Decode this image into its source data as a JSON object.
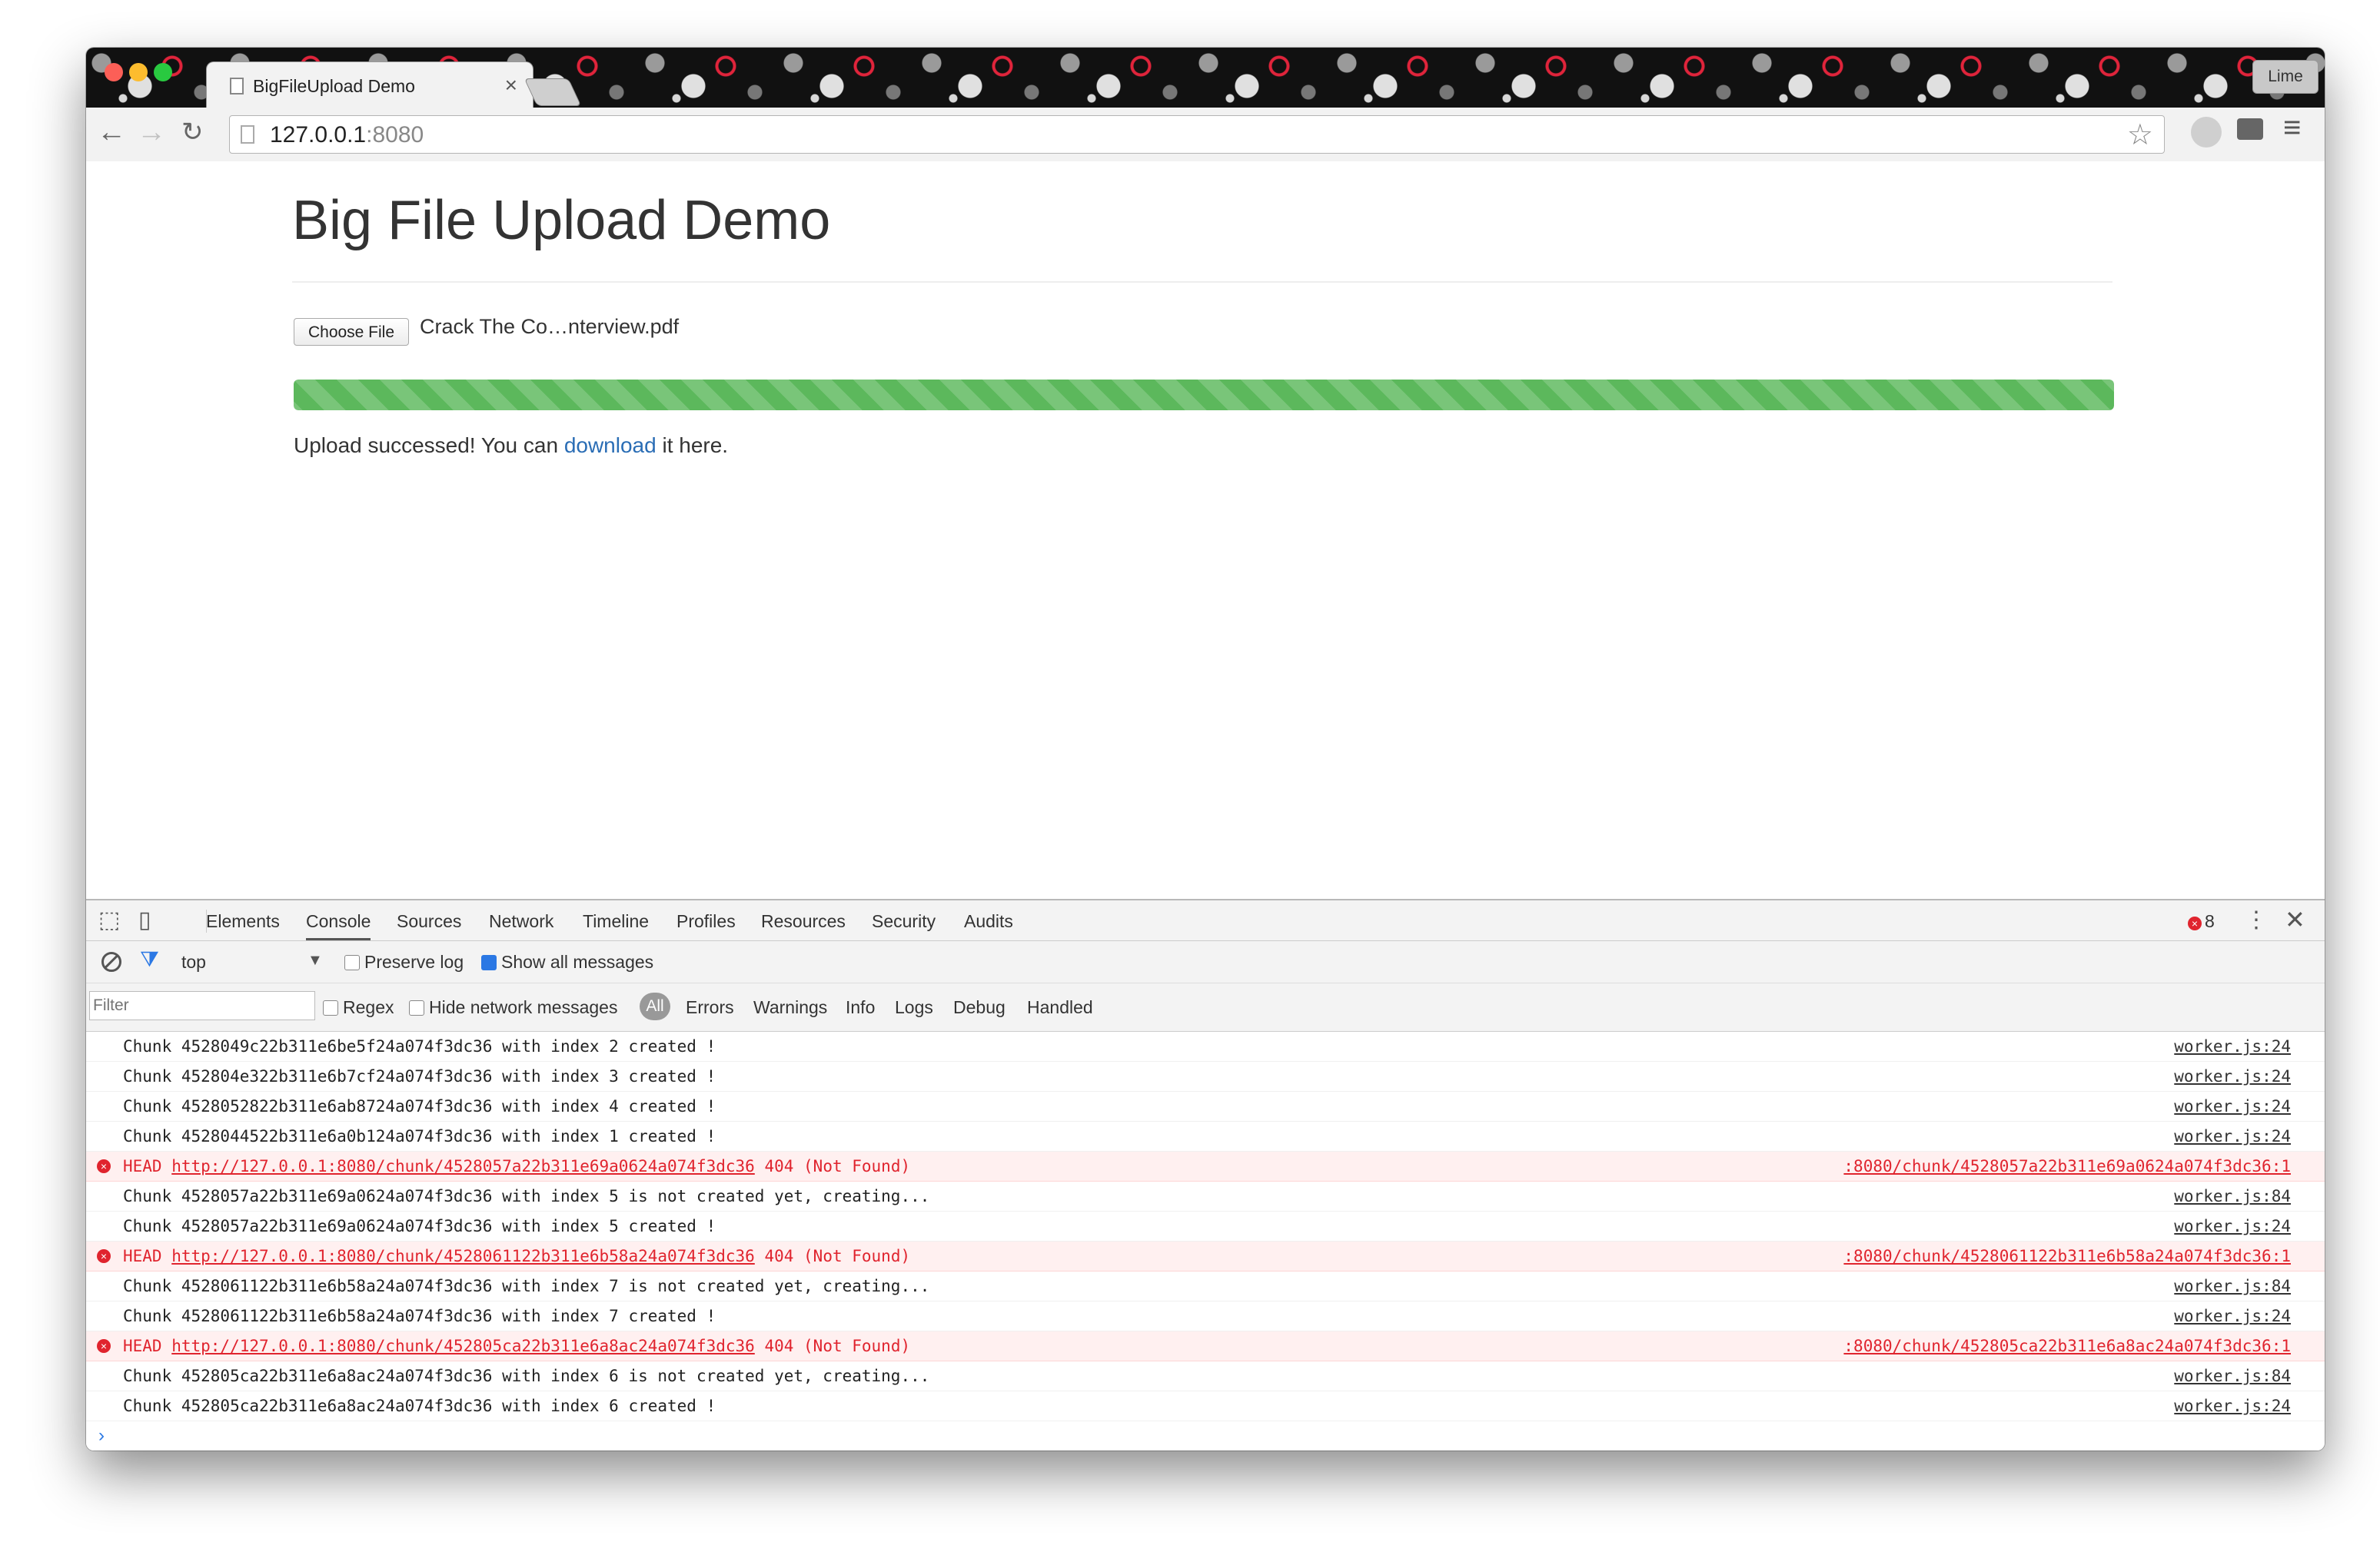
{
  "browser": {
    "tab_title": "BigFileUpload Demo",
    "tab_close": "×",
    "profile_name": "Lime",
    "url_host": "127.0.0.1",
    "url_port": ":8080"
  },
  "page": {
    "title": "Big File Upload Demo",
    "choose_file_label": "Choose File",
    "file_name": "Crack The Co…nterview.pdf",
    "progress_percent": 100,
    "status_prefix": "Upload successed! You can ",
    "status_link": "download",
    "status_suffix": " it here."
  },
  "devtools": {
    "tabs": [
      "Elements",
      "Console",
      "Sources",
      "Network",
      "Timeline",
      "Profiles",
      "Resources",
      "Security",
      "Audits"
    ],
    "active_tab": "Console",
    "error_count": "8",
    "context": "top",
    "preserve_log": "Preserve log",
    "show_all": "Show all messages",
    "filter_placeholder": "Filter",
    "regex": "Regex",
    "hide_network": "Hide network messages",
    "levels": [
      "All",
      "Errors",
      "Warnings",
      "Info",
      "Logs",
      "Debug",
      "Handled"
    ]
  },
  "console_rows": [
    {
      "type": "log",
      "text": "Chunk 4528049c22b311e6be5f24a074f3dc36 with index 2 created !",
      "src": "worker.js:24"
    },
    {
      "type": "log",
      "text": "Chunk 452804e322b311e6b7cf24a074f3dc36 with index 3 created !",
      "src": "worker.js:24"
    },
    {
      "type": "log",
      "text": "Chunk 4528052822b311e6ab8724a074f3dc36 with index 4 created !",
      "src": "worker.js:24"
    },
    {
      "type": "log",
      "text": "Chunk 4528044522b311e6a0b124a074f3dc36 with index 1 created !",
      "src": "worker.js:24"
    },
    {
      "type": "error",
      "method": "HEAD",
      "url": "http://127.0.0.1:8080/chunk/4528057a22b311e69a0624a074f3dc36",
      "status": "404 (Not Found)",
      "src": ":8080/chunk/4528057a22b311e69a0624a074f3dc36:1"
    },
    {
      "type": "log",
      "text": "Chunk 4528057a22b311e69a0624a074f3dc36 with index 5 is not created yet, creating...",
      "src": "worker.js:84"
    },
    {
      "type": "log",
      "text": "Chunk 4528057a22b311e69a0624a074f3dc36 with index 5 created !",
      "src": "worker.js:24"
    },
    {
      "type": "error",
      "method": "HEAD",
      "url": "http://127.0.0.1:8080/chunk/4528061122b311e6b58a24a074f3dc36",
      "status": "404 (Not Found)",
      "src": ":8080/chunk/4528061122b311e6b58a24a074f3dc36:1"
    },
    {
      "type": "log",
      "text": "Chunk 4528061122b311e6b58a24a074f3dc36 with index 7 is not created yet, creating...",
      "src": "worker.js:84"
    },
    {
      "type": "log",
      "text": "Chunk 4528061122b311e6b58a24a074f3dc36 with index 7 created !",
      "src": "worker.js:24"
    },
    {
      "type": "error",
      "method": "HEAD",
      "url": "http://127.0.0.1:8080/chunk/452805ca22b311e6a8ac24a074f3dc36",
      "status": "404 (Not Found)",
      "src": ":8080/chunk/452805ca22b311e6a8ac24a074f3dc36:1"
    },
    {
      "type": "log",
      "text": "Chunk 452805ca22b311e6a8ac24a074f3dc36 with index 6 is not created yet, creating...",
      "src": "worker.js:84"
    },
    {
      "type": "log",
      "text": "Chunk 452805ca22b311e6a8ac24a074f3dc36 with index 6 created !",
      "src": "worker.js:24"
    }
  ],
  "colors": {
    "progress": "#5cb85c",
    "link": "#2a6db5",
    "error": "#e0242e",
    "error_bg": "#fff0f0"
  }
}
